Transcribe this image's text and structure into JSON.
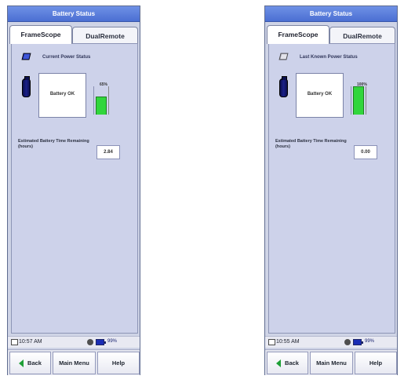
{
  "panels": [
    {
      "title": "Battery Status",
      "tabs": [
        {
          "label": "FrameScope",
          "active": true
        },
        {
          "label": "DualRemote",
          "active": false
        }
      ],
      "power_status": {
        "icon": "battery-card-icon",
        "label": "Current Power Status",
        "box_text": "Battery OK",
        "charge_percent": 65,
        "charge_label": "65%"
      },
      "remaining": {
        "label": "Estimated Battery Time Remaining (hours)",
        "value": "2.84"
      },
      "statusbar": {
        "time": "10:57 AM",
        "battery_text": "99%"
      },
      "buttons": {
        "back": "Back",
        "main_menu": "Main Menu",
        "help": "Help"
      }
    },
    {
      "title": "Battery Status",
      "tabs": [
        {
          "label": "FrameScope",
          "active": true
        },
        {
          "label": "DualRemote",
          "active": false
        }
      ],
      "power_status": {
        "icon": "battery-card-icon",
        "label": "Last Known Power Status",
        "box_text": "Battery OK",
        "charge_percent": 100,
        "charge_label": "100%"
      },
      "remaining": {
        "label": "Estimated Battery Time Remaining (hours)",
        "value": "0.00"
      },
      "statusbar": {
        "time": "10:55 AM",
        "battery_text": "99%"
      },
      "buttons": {
        "back": "Back",
        "main_menu": "Main Menu",
        "help": "Help"
      }
    }
  ],
  "colors": {
    "title_bar": "#4b6fd3",
    "gauge_fill": "#31d63c",
    "battery_icon": "#1a1f8a"
  }
}
